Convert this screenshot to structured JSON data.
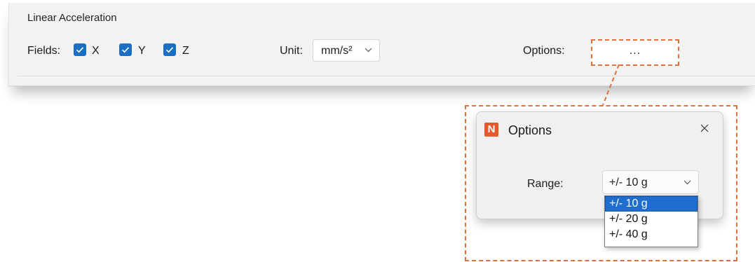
{
  "panel": {
    "title": "Linear Acceleration",
    "fields_label": "Fields:",
    "fields": [
      {
        "label": "X",
        "checked": true
      },
      {
        "label": "Y",
        "checked": true
      },
      {
        "label": "Z",
        "checked": true
      }
    ],
    "unit_label": "Unit:",
    "unit_value": "mm/s²",
    "options_label": "Options:",
    "options_button": "..."
  },
  "dialog": {
    "icon": "N",
    "title": "Options",
    "close": "✕",
    "range_label": "Range:",
    "range_value": "+/- 10 g",
    "range_options": [
      "+/- 10 g",
      "+/- 20 g",
      "+/- 40 g"
    ],
    "selected_index": 0
  },
  "colors": {
    "accent": "#1a6fc4",
    "callout": "#e2703a",
    "app_icon": "#e8582a",
    "selection": "#1f6ecf"
  }
}
